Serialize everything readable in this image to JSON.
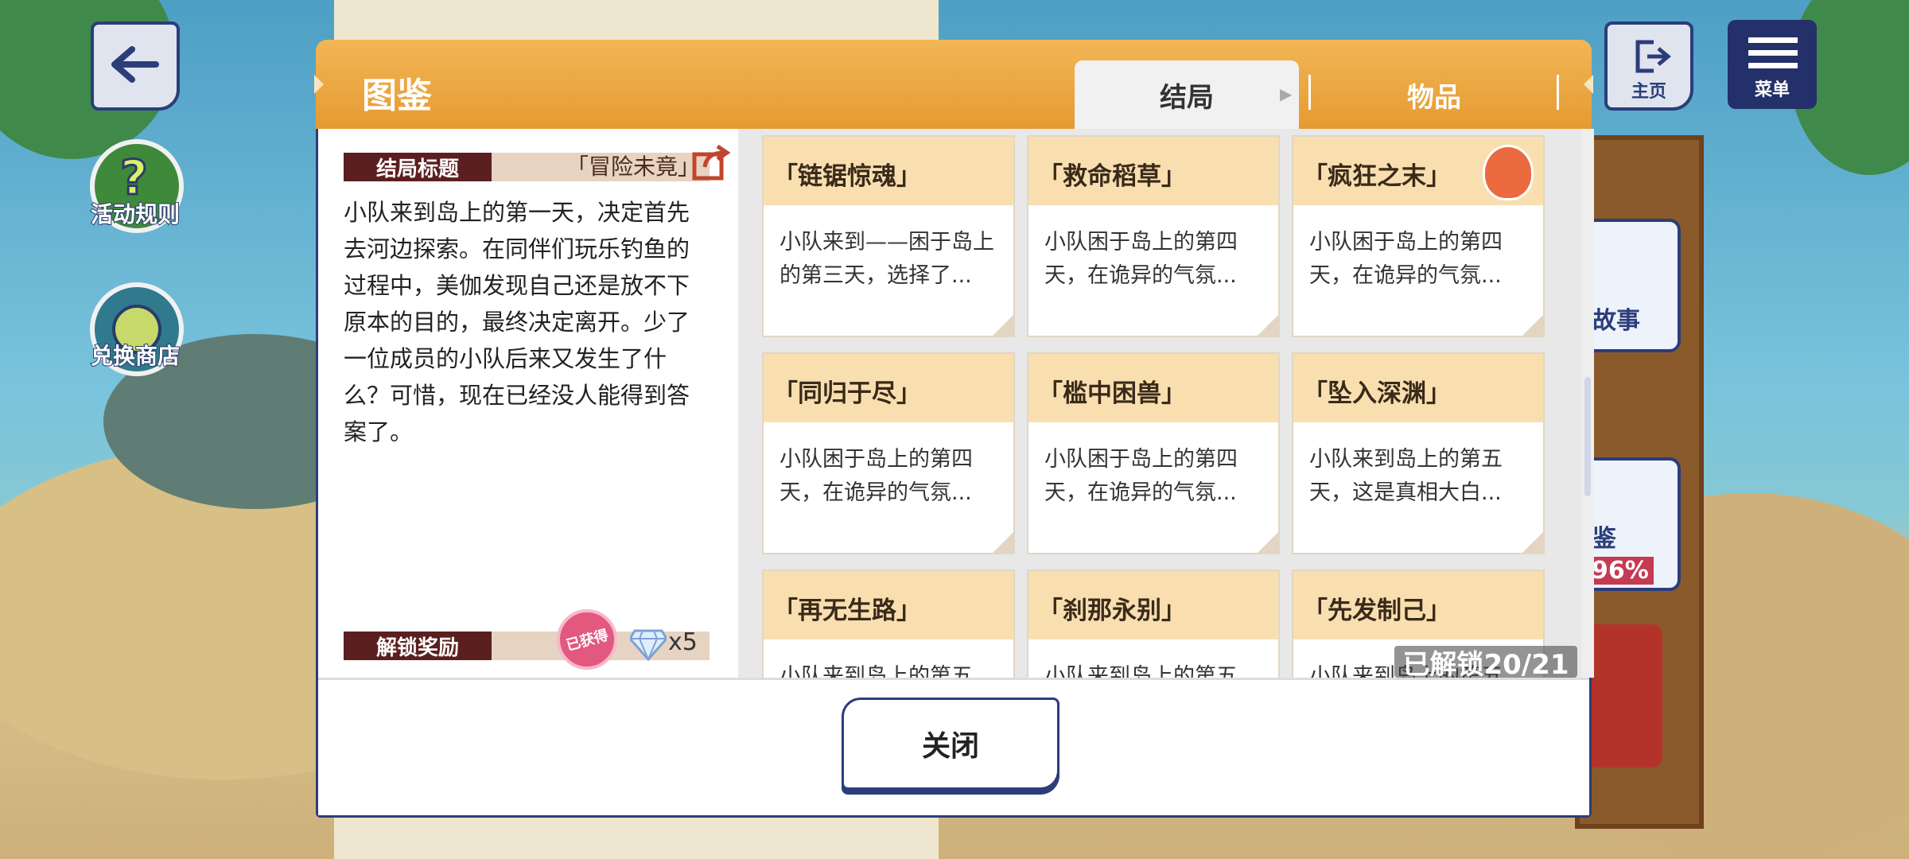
{
  "top_left": {
    "back_icon": "arrow-left-icon"
  },
  "top_right": {
    "home_label": "主页",
    "menu_label": "菜单"
  },
  "left_buttons": {
    "rules_label": "活动规则",
    "shop_label": "兑换商店"
  },
  "side_partial": {
    "story_label": "故事",
    "guide_label": "鉴",
    "guide_pct": "96%"
  },
  "modal": {
    "title": "图鉴",
    "tabs": [
      {
        "label": "结局",
        "active": true
      },
      {
        "label": "物品",
        "active": false
      }
    ],
    "detail": {
      "title_tag": "结局标题",
      "title_value": "「冒险未竟」",
      "share_icon": "share-icon",
      "description": "小队来到岛上的第一天，决定首先去河边探索。在同伴们玩乐钓鱼的过程中，美伽发现自己还是放不下原本的目的，最终决定离开。少了一位成员的小队后来又发生了什么？可惜，现在已经没人能得到答案了。",
      "reward_tag": "解锁奖励",
      "reward_stamp": "已获得",
      "reward_count": "x5"
    },
    "cards": [
      {
        "title": "「链锯惊魂」",
        "desc": "小队来到——困于岛上的第三天，选择了..."
      },
      {
        "title": "「救命稻草」",
        "desc": "小队困于岛上的第四天，在诡异的气氛..."
      },
      {
        "title": "「疯狂之末」",
        "desc": "小队困于岛上的第四天，在诡异的气氛..."
      },
      {
        "title": "「同归于尽」",
        "desc": "小队困于岛上的第四天，在诡异的气氛..."
      },
      {
        "title": "「槛中困兽」",
        "desc": "小队困于岛上的第四天，在诡异的气氛..."
      },
      {
        "title": "「坠入深渊」",
        "desc": "小队来到岛上的第五天，这是真相大白..."
      },
      {
        "title": "「再无生路」",
        "desc": "小队来到岛上的第五"
      },
      {
        "title": "「刹那永别」",
        "desc": "小队来到岛上的第五"
      },
      {
        "title": "「先发制己」",
        "desc": "小队来到岛上的第五"
      }
    ],
    "unlock_status": "已解锁20/21",
    "close_label": "关闭"
  },
  "colors": {
    "header": "#e9a23a",
    "accent_navy": "#2b3d7a",
    "card_head": "#f9dfb0",
    "tag_dark": "#5b1f1f"
  }
}
